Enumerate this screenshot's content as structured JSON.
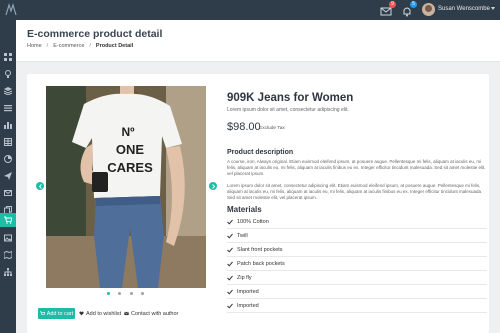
{
  "topbar": {
    "notification_count_1": "9",
    "notification_count_2": "5",
    "user_name": "Susan Wenscombe"
  },
  "colors": {
    "accent": "#1fbba6",
    "sidebar_bg": "#2f3d4a",
    "badge_red": "#ef5350",
    "badge_blue": "#2196f3"
  },
  "sidebar": {
    "icons": [
      "grid-icon",
      "bulb-icon",
      "layers-icon",
      "list-icon",
      "chart-icon",
      "table-icon",
      "pie-icon",
      "send-icon",
      "mail-icon",
      "copy-icon",
      "cart-icon",
      "image-icon",
      "map-icon",
      "sitemap-icon"
    ],
    "active_index": 10
  },
  "header": {
    "title": "E-commerce product detail",
    "breadcrumb": [
      "Home",
      "E-commerce",
      "Product Detail"
    ]
  },
  "product": {
    "title": "909K Jeans for Women",
    "subtitle": "Lorem ipsum dolor sit amet, consectetur adipiscing elit.",
    "price": "$98.00",
    "tax_note": "Exclude Tax",
    "description_heading": "Product description",
    "description_1": "A course, iron, Always original. Etiam euismod eleifend ipsum, at posuere augue. Pellentesque mi felis, aliquam at iaculis eu, mi felis, aliquam at iaculis eu, mi felis, aliquam at iaculis finibus eu ex. Integer efficitur tincidunt malesuada. Sed sit amet molestie elit, vel placerat ipsum.",
    "description_2": "Lorem ipsum dolor sit amet, consectetur adipiscing elit. Etiam euismod eleifend ipsum, at posuere augue. Pellentesque mi felis, aliquam at iaculis eu, mi felis, aliquam at iaculis eu, mi felis, aliquam at iaculis finibus eu ex. Integer efficitur tincidunt malesuada. Sed sit amet molestie elit, vel placerat ipsum.",
    "materials_heading": "Materials",
    "materials": [
      "100% Cotton",
      "Twill",
      "Slant front pockets",
      "Patch back pockets",
      "Zip fly",
      "Imported",
      "Imported"
    ],
    "carousel_count": 4,
    "carousel_active": 0
  },
  "actions": {
    "add_to_cart": "Add to cart",
    "add_to_wishlist": "Add to wishlist",
    "contact_author": "Contact with author"
  }
}
